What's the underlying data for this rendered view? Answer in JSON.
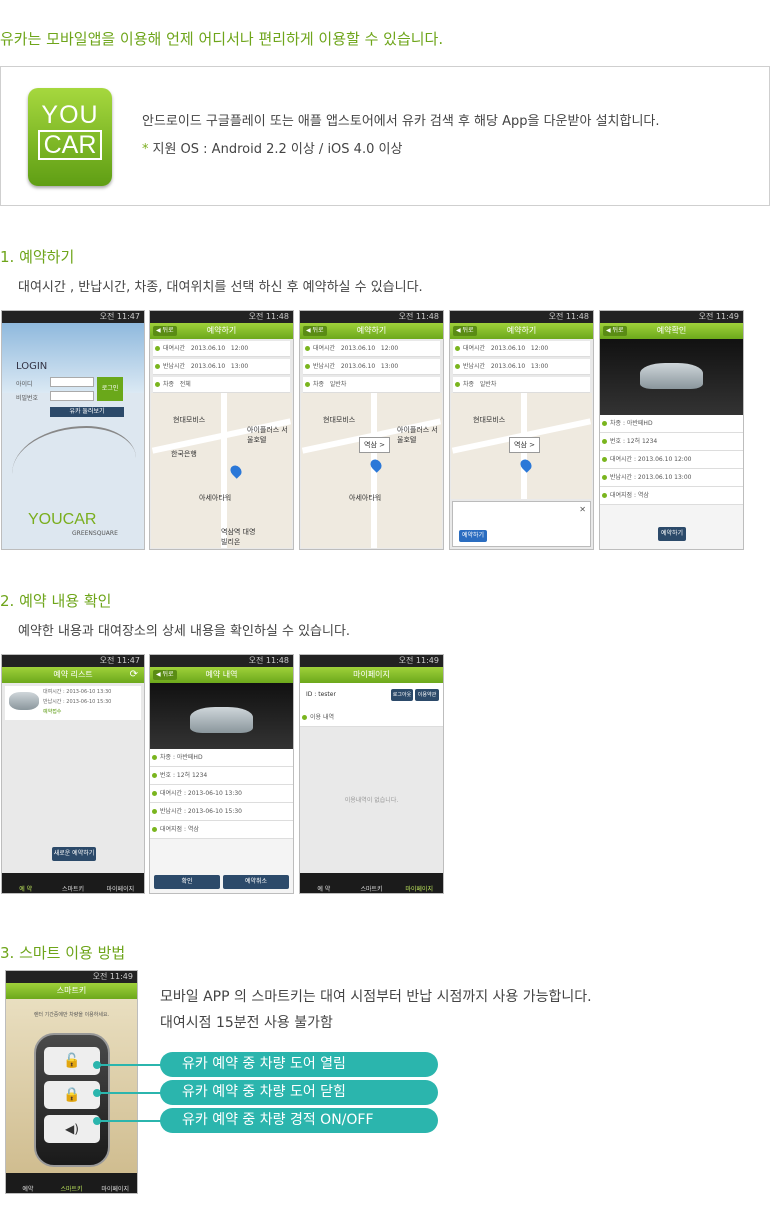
{
  "intro": "유카는 모바일앱을 이용해 언제 어디서나 편리하게 이용할 수 있습니다.",
  "logo": {
    "line1": "YOU",
    "line2": "CAR"
  },
  "info": {
    "download": "안드로이드 구글플레이 또는 애플 앱스토어에서 유카 검색 후 해당 App을 다운받아 설치합니다.",
    "star": "*",
    "os": "지원 OS : Android 2.2 이상 / iOS 4.0 이상"
  },
  "sections": [
    {
      "title": "1. 예약하기",
      "desc": "대여시간 , 반납시간, 차종, 대여위치를 선택 하신 후 예약하실 수 있습니다."
    },
    {
      "title": "2. 예약 내용 확인",
      "desc": "예약한 내용과 대여장소의 상세 내용을 확인하실 수 있습니다."
    },
    {
      "title": "3. 스마트 이용 방법",
      "desc1": "모바일 APP 의 스마트키는 대여 시점부터 반납 시점까지 사용 가능합니다.",
      "desc2": "대여시점 15분전 사용 불가함"
    }
  ],
  "status_times": [
    "오전 11:47",
    "오전 11:48",
    "오전 11:48",
    "오전 11:48",
    "오전 11:49"
  ],
  "screens1": {
    "login": {
      "title": "LOGIN",
      "id_label": "아이디",
      "pw_label": "비밀번호",
      "login_btn": "로그인",
      "join_btn": "유카 둘러보기",
      "brand": "YOUCAR",
      "brand_sub": "GREENSQUARE"
    },
    "reserve": {
      "title": "예약하기",
      "back": "◀ 뒤로",
      "row1": "대여시간",
      "row2": "반납시간",
      "row3": "차종",
      "date1": "2013.06.10",
      "time1": "12:00",
      "date2": "2013.06.10",
      "time2": "13:00",
      "car_all": "전체",
      "car_sel": "일반차",
      "bubble": "역삼 >",
      "map_label1": "현대모비스",
      "map_label2": "아이플러스 서울호텔",
      "map_label3": "한국은행",
      "map_label4": "아세아타워",
      "map_label5": "역삼역 대영빌리온",
      "reserve_btn": "예약하기"
    },
    "confirm": {
      "title": "예약확인",
      "rows": [
        "차종   :  아반떼HD",
        "번호   :  12허 1234",
        "대여시간  :  2013.06.10 12:00",
        "반납시간  :  2013.06.10 13:00",
        "대여지점  :  역삼"
      ],
      "btn": "예약하기"
    }
  },
  "screens2": {
    "list": {
      "title": "예약 리스트",
      "item1": "대여시간 : 2013-06-10 13:30",
      "item2": "반납시간 : 2013-06-10 15:30",
      "item3": "예약접수",
      "new_btn": "새로운 예약하기"
    },
    "detail": {
      "title": "예약 내역",
      "rows": [
        "차종   :  아반떼HD",
        "번호   :  12허 1234",
        "대여시간  :  2013-06-10 13:30",
        "반납시간  :  2013-06-10 15:30",
        "대여지점  :  역삼"
      ],
      "ok_btn": "확인",
      "cancel_btn": "예약취소"
    },
    "mypage": {
      "title": "마이페이지",
      "id": "ID : tester",
      "logout": "로그아웃",
      "change": "이용약관",
      "history_label": "이용 내역",
      "empty": "이용내역이 없습니다."
    },
    "nav": [
      "예 약",
      "스마트키",
      "마이페이지"
    ]
  },
  "smartkey": {
    "title": "스마트키",
    "notice": "렌터 기간중에만 차량을 이용하세요.",
    "pills": [
      "유카 예약 중 차량 도어 열림",
      "유카 예약 중 차량 도어 닫힘",
      "유카 예약 중 차량 경적 ON/OFF"
    ],
    "nav": [
      "예약",
      "스마트키",
      "마이페이지"
    ],
    "time": "오전 11:49"
  }
}
